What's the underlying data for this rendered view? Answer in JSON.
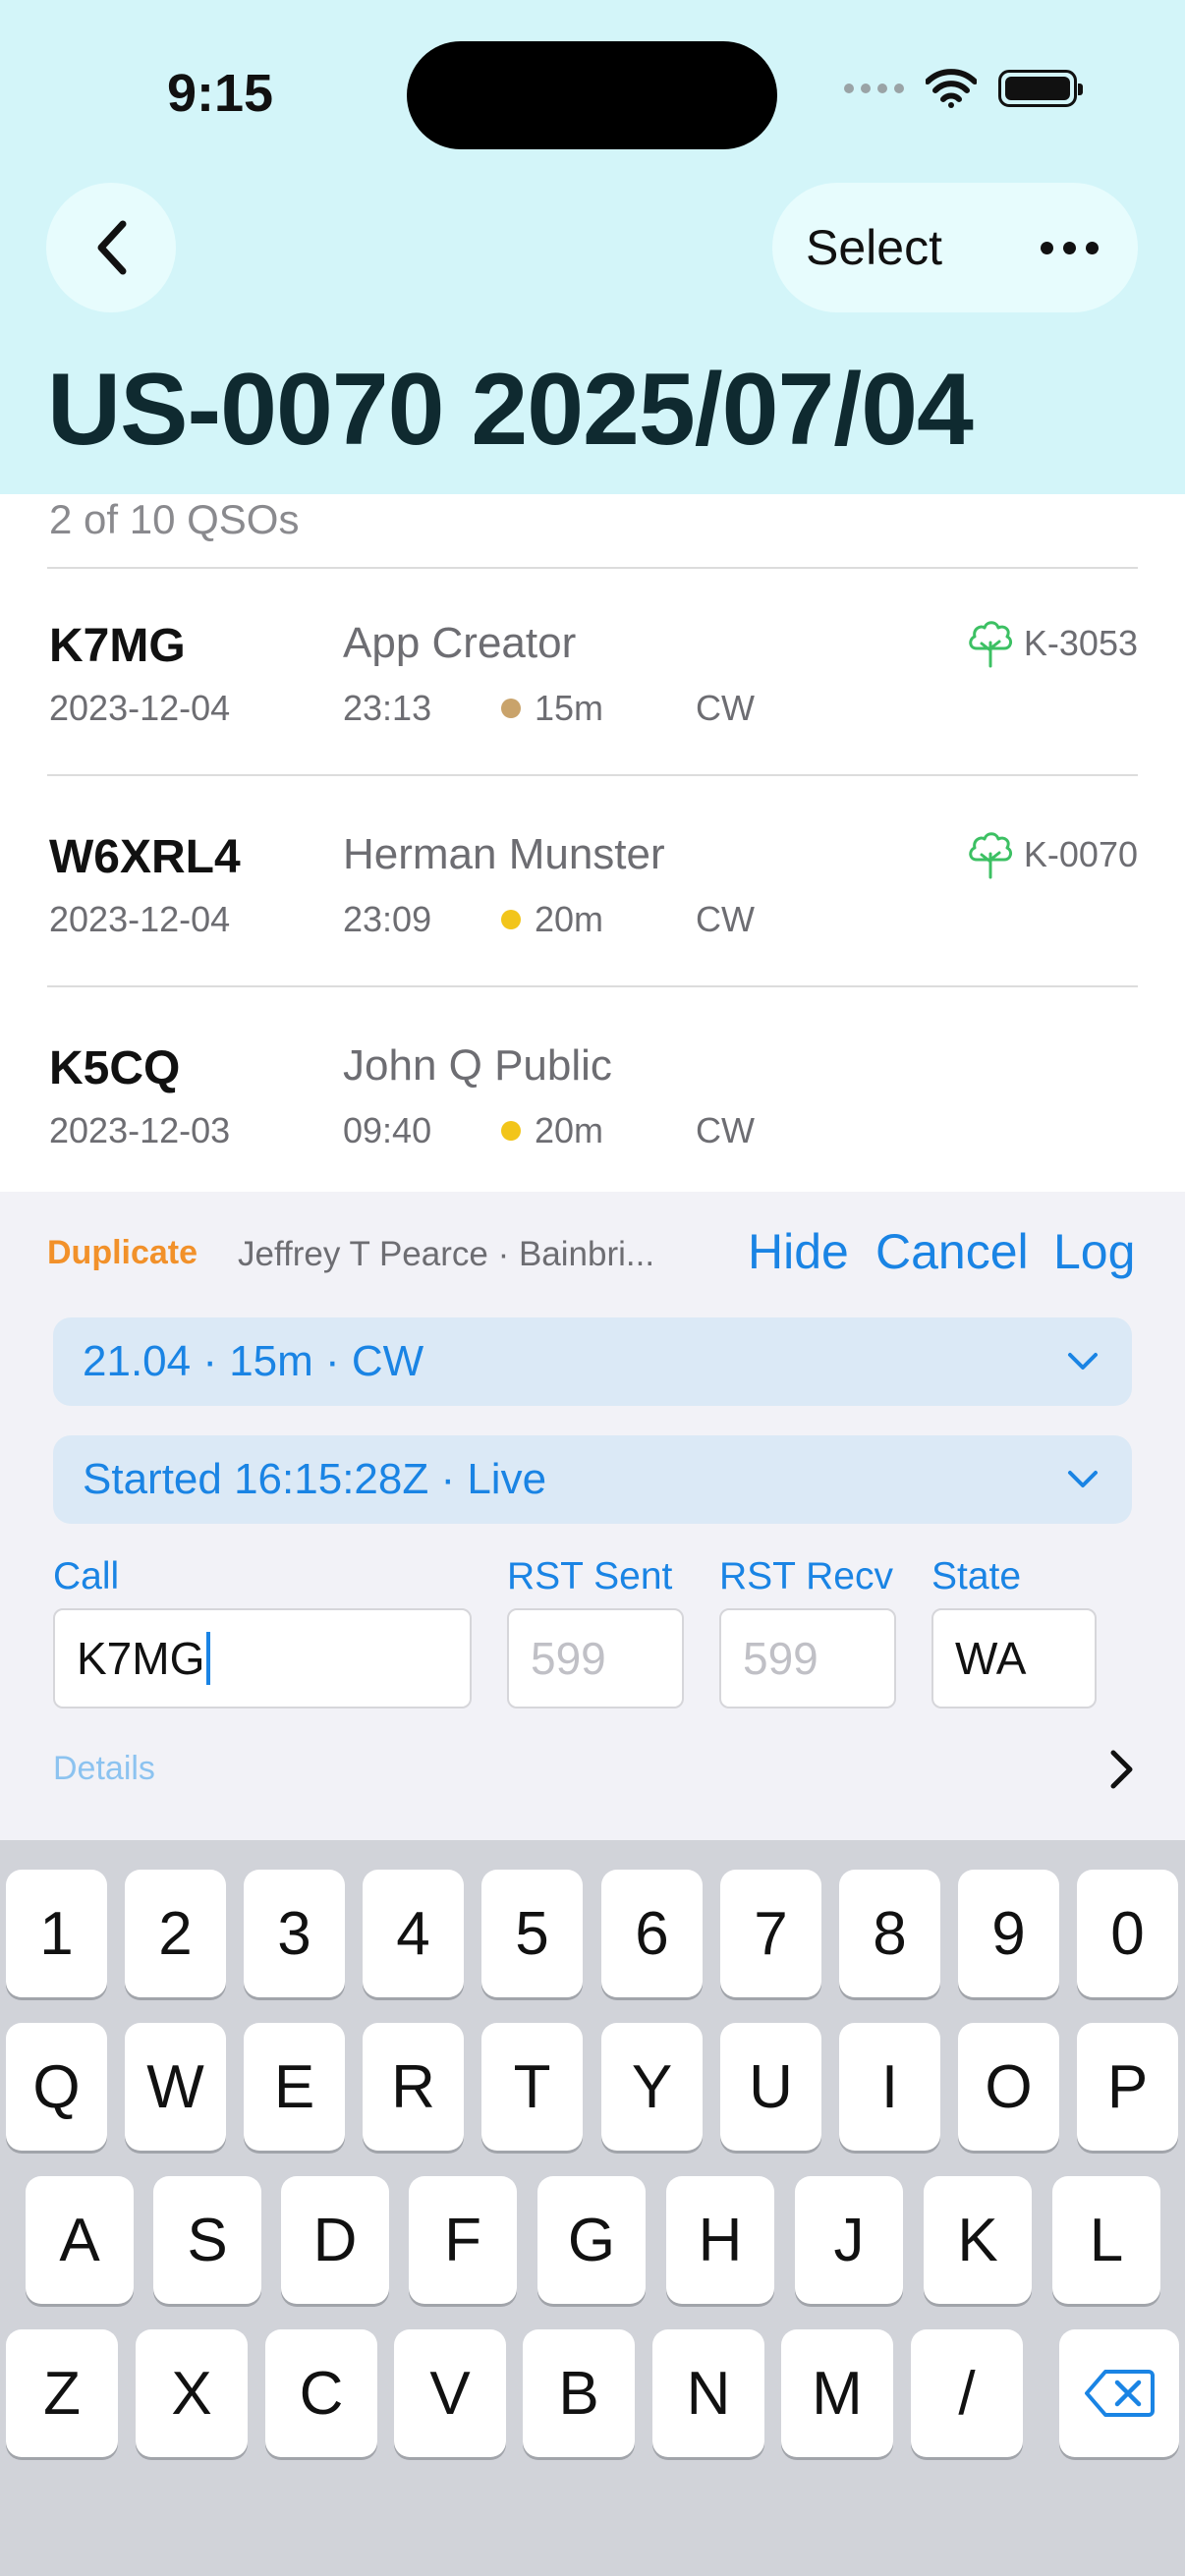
{
  "status_bar": {
    "time": "9:15"
  },
  "nav": {
    "select_label": "Select",
    "title": "US-0070 2025/07/04"
  },
  "list": {
    "count": "2 of 10 QSOs",
    "rows": [
      {
        "call": "K7MG",
        "date": "2023-12-04",
        "name": "App Creator",
        "time": "23:13",
        "band": "15m",
        "band_color": "#c9a36b",
        "mode": "CW",
        "ref": "K-3053"
      },
      {
        "call": "W6XRL4",
        "date": "2023-12-04",
        "name": "Herman Munster",
        "time": "23:09",
        "band": "20m",
        "band_color": "#f2c51a",
        "mode": "CW",
        "ref": "K-0070"
      },
      {
        "call": "K5CQ",
        "date": "2023-12-03",
        "name": "John Q Public",
        "time": "09:40",
        "band": "20m",
        "band_color": "#f2c51a",
        "mode": "CW",
        "ref": ""
      }
    ]
  },
  "entry": {
    "duplicate_label": "Duplicate",
    "duplicate_info": "Jeffrey T Pearce · Bainbri...",
    "hide_label": "Hide",
    "cancel_label": "Cancel",
    "log_label": "Log",
    "frequency_dropdown": "21.04 · 15m · CW",
    "time_dropdown": "Started 16:15:28Z · Live",
    "call_label": "Call",
    "call_value": "K7MG",
    "rst_sent_label": "RST Sent",
    "rst_sent_placeholder": "599",
    "rst_recv_label": "RST Recv",
    "rst_recv_placeholder": "599",
    "state_label": "State",
    "state_value": "WA",
    "details_label": "Details"
  },
  "keyboard": {
    "row1": [
      "1",
      "2",
      "3",
      "4",
      "5",
      "6",
      "7",
      "8",
      "9",
      "0"
    ],
    "row2": [
      "Q",
      "W",
      "E",
      "R",
      "T",
      "Y",
      "U",
      "I",
      "O",
      "P"
    ],
    "row3": [
      "A",
      "S",
      "D",
      "F",
      "G",
      "H",
      "J",
      "K",
      "L"
    ],
    "row4": [
      "Z",
      "X",
      "C",
      "V",
      "B",
      "N",
      "M",
      "/"
    ]
  },
  "colors": {
    "accent": "#1a84e4",
    "duplicate": "#f2912a",
    "header_bg": "#d3f5f9",
    "park_icon": "#3cc063"
  }
}
